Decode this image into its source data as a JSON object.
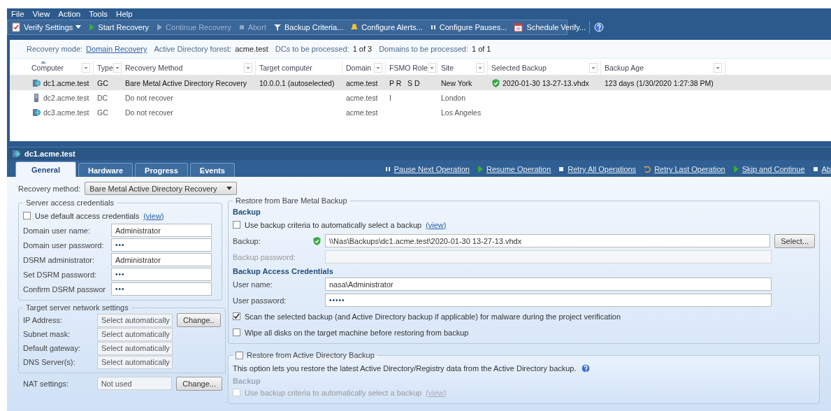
{
  "menu": [
    "File",
    "View",
    "Action",
    "Tools",
    "Help"
  ],
  "toolbar": [
    {
      "label": "Verify Settings",
      "kind": "dropdown",
      "disabled": false
    },
    {
      "label": "Start Recovery",
      "kind": "button",
      "disabled": false
    },
    {
      "label": "Continue Recovery",
      "kind": "button",
      "disabled": true
    },
    {
      "label": "Abort",
      "kind": "button",
      "disabled": true
    },
    {
      "label": "Backup Criteria...",
      "kind": "button",
      "disabled": false
    },
    {
      "label": "Configure Alerts...",
      "kind": "button",
      "disabled": false
    },
    {
      "label": "Configure Pauses...",
      "kind": "button",
      "disabled": false
    },
    {
      "label": "Schedule Verify...",
      "kind": "button",
      "disabled": false
    },
    {
      "kind": "help",
      "disabled": false
    }
  ],
  "summary": [
    {
      "label": "Recovery mode:",
      "value": "Domain Recovery",
      "kind": "link"
    },
    {
      "label": "Active Directory forest:",
      "value": "acme.test",
      "kind": "text"
    },
    {
      "label": "DCs to be processed:",
      "value": "1 of 3",
      "kind": "text"
    },
    {
      "label": "Domains to be processed:",
      "value": "1 of 1",
      "kind": "text"
    }
  ],
  "table": {
    "columns": [
      {
        "label": "Computer",
        "filter": true,
        "sorted": true
      },
      {
        "label": "Type",
        "filter": true,
        "sorted": false
      },
      {
        "label": "Recovery Method",
        "filter": true,
        "sorted": false
      },
      {
        "label": "Target computer",
        "filter": false,
        "sorted": false
      },
      {
        "label": "Domain",
        "filter": true,
        "sorted": false
      },
      {
        "label": "FSMO Role",
        "filter": true,
        "sorted": false
      },
      {
        "label": "Site",
        "filter": true,
        "sorted": false
      },
      {
        "label": "Selected Backup",
        "filter": true,
        "sorted": false
      },
      {
        "label": "Backup Age",
        "filter": true,
        "sorted": false
      }
    ],
    "rows": [
      {
        "kind": "global-catalog",
        "selected": true,
        "verified": true,
        "cells": [
          "dc1.acme.test",
          "GC",
          "Bare Metal Active Directory Recovery",
          "10.0.0.1 (autoselected)",
          "acme.test",
          "P R   S D",
          "New York",
          "2020-01-30 13-27-13.vhdx",
          "123 days (1/30/2020 1:27:38 PM)"
        ]
      },
      {
        "kind": "domain-controller",
        "selected": false,
        "verified": false,
        "cells": [
          "dc2.acme.test",
          "DC",
          "Do not recover",
          "",
          "acme.test",
          "I",
          "London",
          "",
          ""
        ]
      },
      {
        "kind": "global-catalog",
        "selected": false,
        "verified": false,
        "cells": [
          "dc3.acme.test",
          "GC",
          "Do not recover",
          "",
          "acme.test",
          "",
          "Los Angeles",
          "",
          ""
        ]
      }
    ]
  },
  "detail": {
    "title": "dc1.acme.test",
    "tabs": [
      {
        "label": "General",
        "selected": true
      },
      {
        "label": "Hardware",
        "selected": false
      },
      {
        "label": "Progress",
        "selected": false
      },
      {
        "label": "Events",
        "selected": false
      }
    ],
    "actions": [
      "Pause Next Operation",
      "Resume Operation",
      "Retry All Operations",
      "Retry Last Operation",
      "Skip and Continue",
      "Ab"
    ],
    "recovery_method": {
      "label": "Recovery method:",
      "value": "Bare Metal Active Directory Recovery"
    },
    "credentials": {
      "title": "Server access credentials",
      "default_credentials": {
        "label": "Use default access credentials",
        "link": "(view)",
        "checked": false
      },
      "fields": [
        {
          "label": "Domain user name:",
          "value": "Administrator",
          "kind": "text"
        },
        {
          "label": "Domain user password:",
          "value": "•••",
          "kind": "password"
        },
        {
          "label": "DSRM administrator:",
          "value": "Administrator",
          "kind": "text"
        },
        {
          "label": "Set DSRM password:",
          "value": "•••",
          "kind": "password"
        },
        {
          "label": "Confirm DSRM passwor",
          "value": "•••",
          "kind": "password"
        }
      ]
    },
    "network": {
      "title": "Target server network settings",
      "fields": [
        {
          "label": "IP Address:",
          "value": "Select automatically",
          "button": "Change.."
        },
        {
          "label": "Subnet mask:",
          "value": "Select automatically"
        },
        {
          "label": "Default gateway:",
          "value": "Select automatically"
        },
        {
          "label": "DNS Server(s):",
          "value": "Select automatically"
        }
      ]
    },
    "nat": {
      "label": "NAT settings:",
      "value": "Not used",
      "button": "Change..."
    },
    "bare_metal": {
      "title": "Restore from Bare Metal Backup",
      "heading": "Backup",
      "criteria": {
        "label": "Use backup criteria to automatically select a backup",
        "link": "(view)",
        "checked": false
      },
      "backup": {
        "label": "Backup:",
        "value": "\\\\Nas\\Backups\\dc1.acme.test\\2020-01-30 13-27-13.vhdx",
        "verified": true,
        "button": "Select..."
      },
      "backup_password": {
        "label": "Backup password:",
        "disabled": true
      },
      "access_heading": "Backup Access Credentials",
      "fields": [
        {
          "label": "User name:",
          "value": "nasa\\Administrator"
        },
        {
          "label": "User password:",
          "value": "•••••"
        }
      ],
      "options": [
        {
          "label": "Scan the selected backup (and Active Directory backup if applicable) for malware during the project verification",
          "checked": true
        },
        {
          "label": "Wipe all disks on the target machine before restoring from backup",
          "checked": false
        }
      ]
    },
    "ad_backup": {
      "title": "Restore from Active Directory Backup",
      "checked": false,
      "note": "This option lets you restore the latest Active Directory/Registry data from the Active Directory backup.",
      "heading": "Backup",
      "criteria": {
        "label": "Use backup criteria to automatically select a backup",
        "link": "(view)",
        "checked": false,
        "disabled": true
      }
    }
  }
}
